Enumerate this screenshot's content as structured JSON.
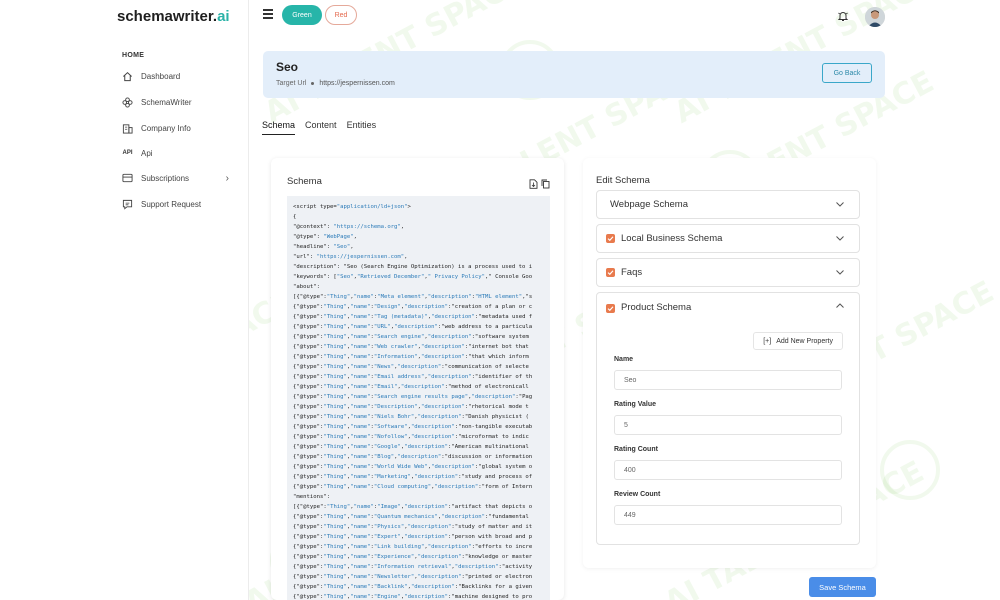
{
  "app": {
    "logo_main": "schemawriter.",
    "logo_suffix": "ai"
  },
  "sidebar": {
    "section": "HOME",
    "items": [
      {
        "label": "Dashboard",
        "icon": "home-icon"
      },
      {
        "label": "SchemaWriter",
        "icon": "flower-icon"
      },
      {
        "label": "Company Info",
        "icon": "building-icon"
      },
      {
        "label": "Api",
        "icon": "api-icon"
      },
      {
        "label": "Subscriptions",
        "icon": "card-icon"
      },
      {
        "label": "Support Request",
        "icon": "support-icon"
      }
    ]
  },
  "topbar": {
    "theme_green": "Green",
    "theme_red": "Red"
  },
  "header": {
    "title": "Seo",
    "target_label": "Target Url",
    "target_url": "https://jespernissen.com",
    "back_label": "Go Back"
  },
  "tabs": [
    "Schema",
    "Content",
    "Entities"
  ],
  "schema_panel": {
    "title": "Schema",
    "code_lines": [
      "<script type=\"application/ld+json\">",
      "{",
      "\"@context\": \"https://schema.org\",",
      "\"@type\": \"WebPage\",",
      "\"headline\": \"Seo\",",
      "\"url\": \"https://jespernissen.com\",",
      "\"description\": \"Seo (Search Engine Optimization) is a process used to i",
      "\"keywords\": [\"Seo\",\"Retrieved December\",\" Privacy Policy\",\" Console Goo",
      "\"about\":",
      "[{\"@type\":\"Thing\",\"name\":\"Meta element\",\"description\":\"HTML element\",\"s",
      "{\"@type\":\"Thing\",\"name\":\"Design\",\"description\":\"creation of a plan or c",
      "{\"@type\":\"Thing\",\"name\":\"Tag (metadata)\",\"description\":\"metadata used f",
      "{\"@type\":\"Thing\",\"name\":\"URL\",\"description\":\"web address to a particula",
      "{\"@type\":\"Thing\",\"name\":\"Search engine\",\"description\":\"software system",
      "{\"@type\":\"Thing\",\"name\":\"Web crawler\",\"description\":\"internet bot that",
      "{\"@type\":\"Thing\",\"name\":\"Information\",\"description\":\"that which inform",
      "{\"@type\":\"Thing\",\"name\":\"News\",\"description\":\"communication of selecte",
      "{\"@type\":\"Thing\",\"name\":\"Email address\",\"description\":\"identifier of th",
      "{\"@type\":\"Thing\",\"name\":\"Email\",\"description\":\"method of electronicall",
      "{\"@type\":\"Thing\",\"name\":\"Search engine results page\",\"description\":\"Pag",
      "{\"@type\":\"Thing\",\"name\":\"Description\",\"description\":\"rhetorical mode t",
      "{\"@type\":\"Thing\",\"name\":\"Niels Bohr\",\"description\":\"Danish physicist (",
      "{\"@type\":\"Thing\",\"name\":\"Software\",\"description\":\"non-tangible executab",
      "{\"@type\":\"Thing\",\"name\":\"Nofollow\",\"description\":\"microformat to indic",
      "{\"@type\":\"Thing\",\"name\":\"Google\",\"description\":\"American multinational",
      "{\"@type\":\"Thing\",\"name\":\"Blog\",\"description\":\"discussion or information",
      "{\"@type\":\"Thing\",\"name\":\"World Wide Web\",\"description\":\"global system o",
      "{\"@type\":\"Thing\",\"name\":\"Marketing\",\"description\":\"study and process of",
      "{\"@type\":\"Thing\",\"name\":\"Cloud computing\",\"description\":\"form of Intern",
      "\"mentions\":",
      "[{\"@type\":\"Thing\",\"name\":\"Image\",\"description\":\"artifact that depicts o",
      "{\"@type\":\"Thing\",\"name\":\"Quantum mechanics\",\"description\":\"fundamental",
      "{\"@type\":\"Thing\",\"name\":\"Physics\",\"description\":\"study of matter and it",
      "{\"@type\":\"Thing\",\"name\":\"Expert\",\"description\":\"person with broad and p",
      "{\"@type\":\"Thing\",\"name\":\"Link building\",\"description\":\"efforts to incre",
      "{\"@type\":\"Thing\",\"name\":\"Experience\",\"description\":\"knowledge or master",
      "{\"@type\":\"Thing\",\"name\":\"Information retrieval\",\"description\":\"activity",
      "{\"@type\":\"Thing\",\"name\":\"Newsletter\",\"description\":\"printed or electron",
      "{\"@type\":\"Thing\",\"name\":\"Backlink\",\"description\":\"Backlinks for a given",
      "{\"@type\":\"Thing\",\"name\":\"Engine\",\"description\":\"machine designed to pro"
    ]
  },
  "edit_panel": {
    "title": "Edit Schema",
    "accordions": [
      {
        "label": "Webpage Schema",
        "checked": false
      },
      {
        "label": "Local Business Schema",
        "checked": true
      },
      {
        "label": "Faqs",
        "checked": true
      },
      {
        "label": "Product Schema",
        "checked": true
      }
    ],
    "add_property_label": "Add New Property",
    "fields": [
      {
        "label": "Name",
        "value": "Seo"
      },
      {
        "label": "Rating Value",
        "value": "5"
      },
      {
        "label": "Rating Count",
        "value": "400"
      },
      {
        "label": "Review Count",
        "value": "449"
      }
    ],
    "save_label": "Save Schema"
  },
  "watermark_text": "AI TALENT SPACE",
  "colors": {
    "accent_teal": "#27b5a9",
    "checkbox_orange": "#e87a4d",
    "save_blue": "#4a8de8",
    "header_bg": "#e3eefa"
  }
}
